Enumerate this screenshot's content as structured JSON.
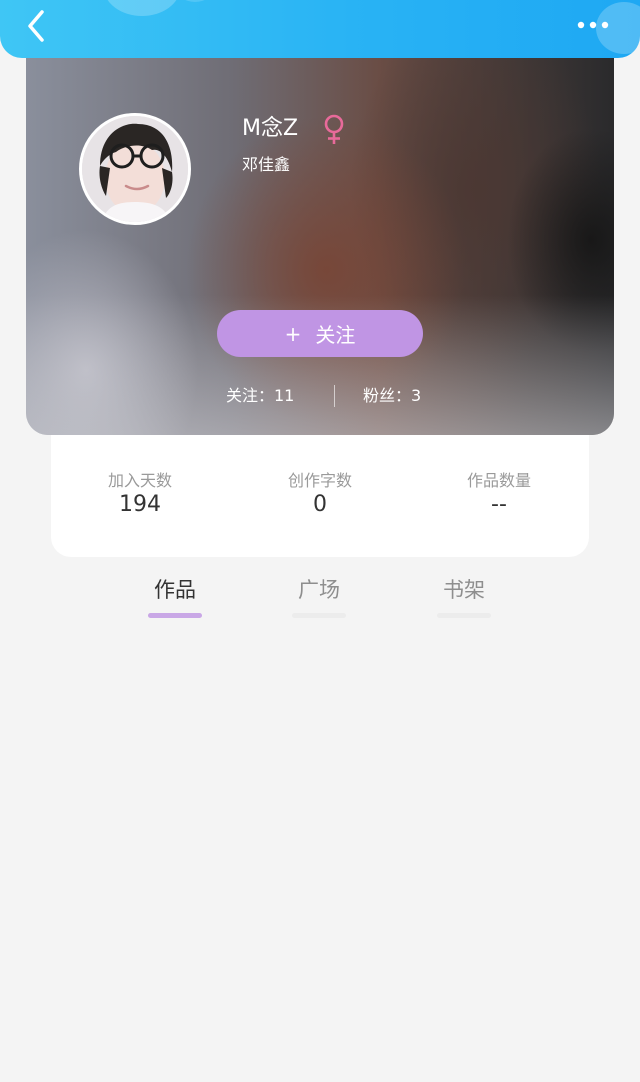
{
  "header": {
    "back_icon": "chevron-left-icon",
    "more_icon": "more-dots-icon"
  },
  "profile": {
    "username": "M念Z",
    "gender_icon": "female-icon",
    "real_name": "邓佳鑫",
    "follow_button": {
      "plus": "+",
      "label": "关注"
    },
    "following": "关注：11",
    "followers": "粉丝：3"
  },
  "stats": [
    {
      "label": "加入天数",
      "value": "194"
    },
    {
      "label": "创作字数",
      "value": "0"
    },
    {
      "label": "作品数量",
      "value": "--"
    }
  ],
  "tabs": [
    {
      "label": "作品",
      "active": true
    },
    {
      "label": "广场",
      "active": false
    },
    {
      "label": "书架",
      "active": false
    }
  ],
  "colors": {
    "header_start": "#3fc6f5",
    "header_end": "#1ea8f3",
    "follow_button": "#c095e4",
    "active_tab_underline": "#c9a7e6",
    "gender_female": "#e86a9a"
  }
}
